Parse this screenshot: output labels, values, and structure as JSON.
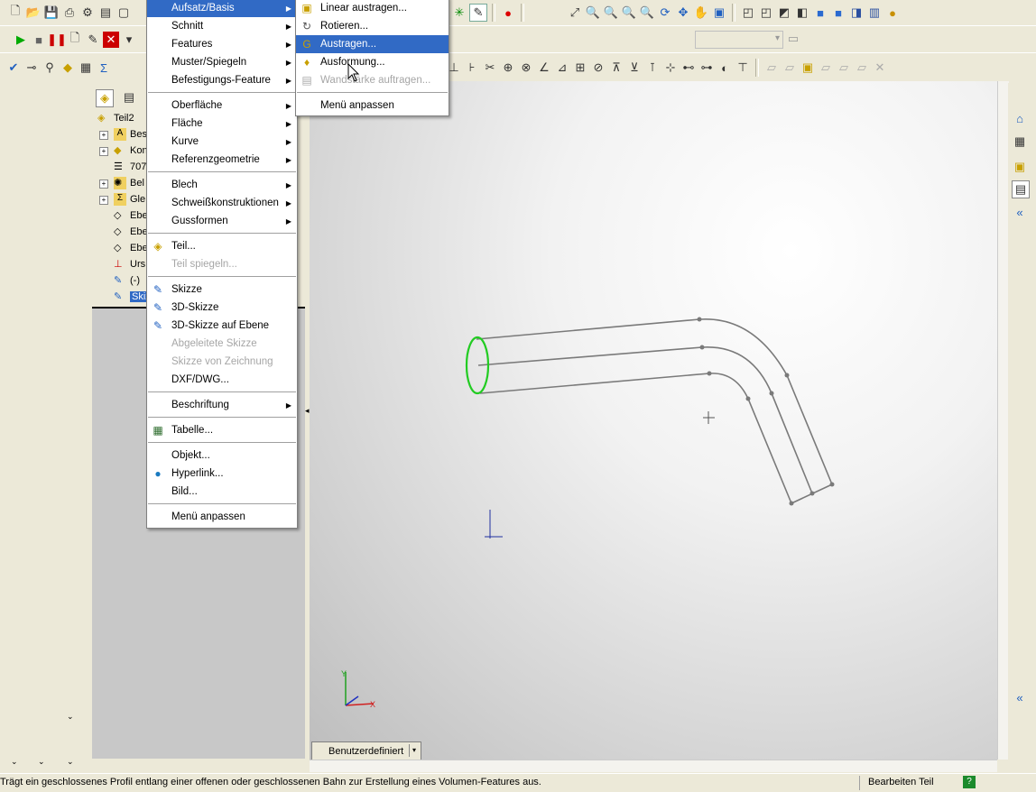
{
  "menus": {
    "main": {
      "items": [
        {
          "label": "Aufsatz/Basis",
          "submenu": true,
          "selected": true
        },
        {
          "label": "Schnitt",
          "submenu": true
        },
        {
          "label": "Features",
          "submenu": true
        },
        {
          "label": "Muster/Spiegeln",
          "submenu": true
        },
        {
          "label": "Befestigungs-Feature",
          "submenu": true
        },
        {
          "label": "Oberfläche",
          "submenu": true
        },
        {
          "label": "Fläche",
          "submenu": true
        },
        {
          "label": "Kurve",
          "submenu": true
        },
        {
          "label": "Referenzgeometrie",
          "submenu": true
        },
        {
          "label": "Blech",
          "submenu": true
        },
        {
          "label": "Schweißkonstruktionen",
          "submenu": true
        },
        {
          "label": "Gussformen",
          "submenu": true
        },
        {
          "label": "Teil...",
          "icon": "part-icon"
        },
        {
          "label": "Teil spiegeln...",
          "disabled": true
        },
        {
          "label": "Skizze",
          "icon": "sketch-icon"
        },
        {
          "label": "3D-Skizze",
          "icon": "3d-sketch-icon"
        },
        {
          "label": "3D-Skizze auf Ebene",
          "icon": "3d-sketch-plane-icon"
        },
        {
          "label": "Abgeleitete Skizze",
          "disabled": true
        },
        {
          "label": "Skizze von Zeichnung",
          "disabled": true
        },
        {
          "label": "DXF/DWG..."
        },
        {
          "label": "Beschriftung",
          "submenu": true
        },
        {
          "label": "Tabelle...",
          "icon": "table-icon"
        },
        {
          "label": "Objekt..."
        },
        {
          "label": "Hyperlink...",
          "icon": "globe-icon"
        },
        {
          "label": "Bild..."
        },
        {
          "label": "Menü anpassen"
        }
      ]
    },
    "sub": {
      "items": [
        {
          "label": "Linear austragen...",
          "icon": "extrude-icon"
        },
        {
          "label": "Rotieren...",
          "icon": "revolve-icon"
        },
        {
          "label": "Austragen...",
          "icon": "sweep-icon",
          "selected": true
        },
        {
          "label": "Ausformung...",
          "icon": "loft-icon"
        },
        {
          "label": "Wandstärke auftragen...",
          "icon": "thicken-icon",
          "disabled": true
        },
        {
          "label": "Menü anpassen"
        }
      ]
    }
  },
  "tree": {
    "root": "Teil2",
    "items": [
      "Bes",
      "Kon",
      "707",
      "Bel",
      "Gle",
      "Ebe",
      "Ebe",
      "Ebe",
      "Urs",
      "(-)",
      "Skiz"
    ]
  },
  "viewport": {
    "view_label": "Benutzerdefiniert"
  },
  "status": {
    "message": "Trägt ein geschlossenes Profil entlang einer offenen oder geschlossenen Bahn zur Erstellung eines Volumen-Features aus.",
    "mode": "Bearbeiten Teil"
  },
  "colors": {
    "menu_highlight": "#316ac5",
    "profile_circle": "#22cc22",
    "axis_x": "#d02020",
    "axis_y": "#20a020",
    "sketch_lines": "#7a7a7a"
  }
}
